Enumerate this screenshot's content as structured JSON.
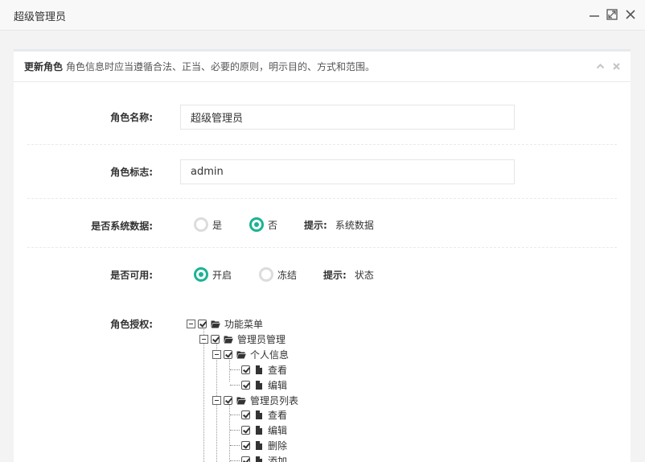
{
  "window": {
    "title": "超级管理员"
  },
  "panel": {
    "title": "更新角色",
    "description": "角色信息时应当遵循合法、正当、必要的原则，明示目的、方式和范围。"
  },
  "form": {
    "role_name": {
      "label": "角色名称:",
      "value": "超级管理员"
    },
    "role_key": {
      "label": "角色标志:",
      "value": "admin"
    },
    "is_system": {
      "label": "是否系统数据:",
      "options": [
        "是",
        "否"
      ],
      "selected": "否",
      "hint_label": "提示:",
      "hint_text": "系统数据"
    },
    "is_enabled": {
      "label": "是否可用:",
      "options": [
        "开启",
        "冻结"
      ],
      "selected": "开启",
      "hint_label": "提示:",
      "hint_text": "状态"
    },
    "permissions": {
      "label": "角色授权:",
      "tree": {
        "label": "功能菜单",
        "children": [
          {
            "label": "管理员管理",
            "children": [
              {
                "label": "个人信息",
                "children": [
                  "查看",
                  "编辑"
                ]
              },
              {
                "label": "管理员列表",
                "children": [
                  "查看",
                  "编辑",
                  "删除",
                  "添加"
                ]
              }
            ]
          }
        ]
      }
    }
  },
  "colors": {
    "accent": "#1ab394"
  }
}
